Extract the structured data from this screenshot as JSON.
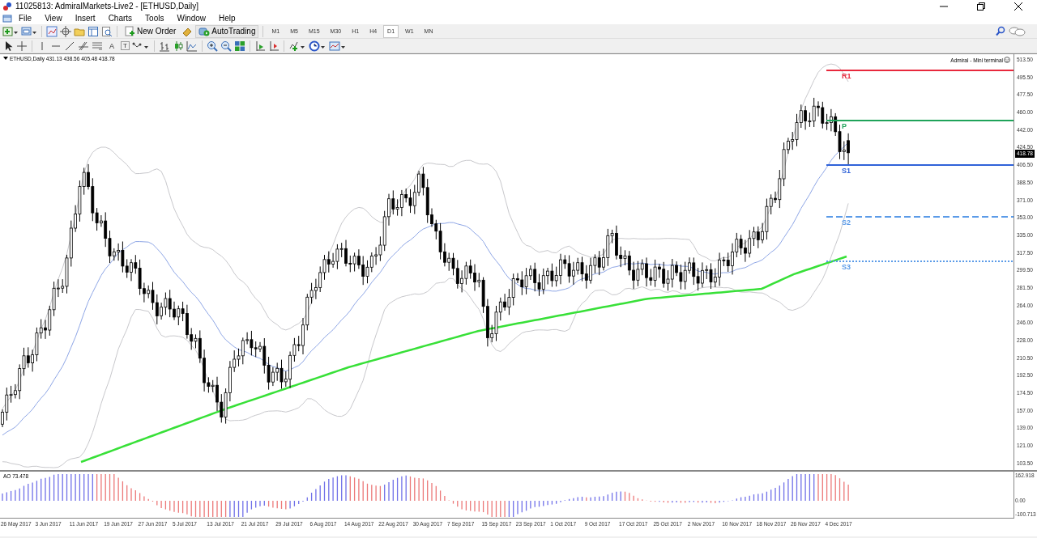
{
  "window": {
    "title": "11025813: AdmiralMarkets-Live2 - [ETHUSD,Daily]"
  },
  "menu": [
    "File",
    "View",
    "Insert",
    "Charts",
    "Tools",
    "Window",
    "Help"
  ],
  "toolbar": {
    "new_order": "New Order",
    "autotrading": "AutoTrading",
    "timeframes": [
      {
        "label": "M1",
        "selected": false
      },
      {
        "label": "M5",
        "selected": false
      },
      {
        "label": "M15",
        "selected": false
      },
      {
        "label": "M30",
        "selected": false
      },
      {
        "label": "H1",
        "selected": false
      },
      {
        "label": "H4",
        "selected": false
      },
      {
        "label": "D1",
        "selected": true
      },
      {
        "label": "W1",
        "selected": false
      },
      {
        "label": "MN",
        "selected": false
      }
    ]
  },
  "drawing_tools": [
    {
      "kind": "text",
      "label": "A"
    },
    {
      "kind": "label",
      "label": "T"
    }
  ],
  "chart": {
    "legend": "ETHUSD,Daily  431.13 438.56 405.48 418.78",
    "terminal": "Admiral - Mini terminal",
    "price_labels": [
      "513.50",
      "495.50",
      "477.50",
      "460.00",
      "442.00",
      "424.50",
      "406.50",
      "388.50",
      "371.00",
      "353.00",
      "335.00",
      "317.50",
      "299.50",
      "281.50",
      "264.00",
      "246.00",
      "228.00",
      "210.50",
      "192.50",
      "174.50",
      "157.00",
      "139.00",
      "121.00",
      "103.50"
    ],
    "current_price": "418.78",
    "pivots": [
      {
        "label": "R1",
        "color": "#e8283c",
        "kind": "solid"
      },
      {
        "label": "P",
        "color": "#1fa35a",
        "kind": "solid"
      },
      {
        "label": "S1",
        "color": "#2f62d8",
        "kind": "solid"
      },
      {
        "label": "S2",
        "color": "#5b9be8",
        "kind": "dashed"
      },
      {
        "label": "S3",
        "color": "#5b9be8",
        "kind": "dotted"
      }
    ]
  },
  "indicator": {
    "label": "AO 73.478",
    "axis_labels": [
      "162.918",
      "0.00",
      "-100.713"
    ]
  },
  "dates": [
    "26 May 2017",
    "3 Jun 2017",
    "11 Jun 2017",
    "19 Jun 2017",
    "27 Jun 2017",
    "5 Jul 2017",
    "13 Jul 2017",
    "21 Jul 2017",
    "29 Jul 2017",
    "6 Aug 2017",
    "14 Aug 2017",
    "22 Aug 2017",
    "30 Aug 2017",
    "7 Sep 2017",
    "15 Sep 2017",
    "23 Sep 2017",
    "1 Oct 2017",
    "9 Oct 2017",
    "17 Oct 2017",
    "25 Oct 2017",
    "2 Nov 2017",
    "10 Nov 2017",
    "18 Nov 2017",
    "26 Nov 2017",
    "4 Dec 2017"
  ]
}
